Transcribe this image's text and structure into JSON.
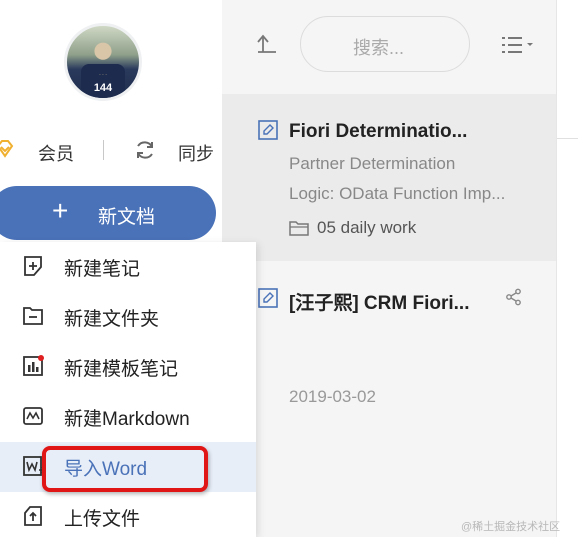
{
  "sidebar": {
    "member_label": "会员",
    "sync_label": "同步",
    "new_doc_label": "新文档",
    "avatar_number": "144"
  },
  "menu": {
    "items": [
      {
        "label": "新建笔记",
        "icon": "new-note-icon"
      },
      {
        "label": "新建文件夹",
        "icon": "new-folder-icon"
      },
      {
        "label": "新建模板笔记",
        "icon": "template-note-icon"
      },
      {
        "label": "新建Markdown",
        "icon": "markdown-icon"
      },
      {
        "label": "导入Word",
        "icon": "import-word-icon"
      },
      {
        "label": "上传文件",
        "icon": "upload-file-icon"
      }
    ],
    "active_index": 4
  },
  "toolbar": {
    "search_placeholder": "搜索..."
  },
  "notes": [
    {
      "title": "Fiori Determinatio...",
      "snippet_line1": "Partner Determination",
      "snippet_line2": "Logic: OData Function Imp...",
      "folder": "05  daily work"
    },
    {
      "title": "[汪子熙] CRM Fiori...",
      "date": "2019-03-02"
    }
  ],
  "watermark": "@稀土掘金技术社区",
  "colors": {
    "accent": "#4a72b8",
    "highlight_border": "#e01515",
    "vip": "#f0b030"
  }
}
